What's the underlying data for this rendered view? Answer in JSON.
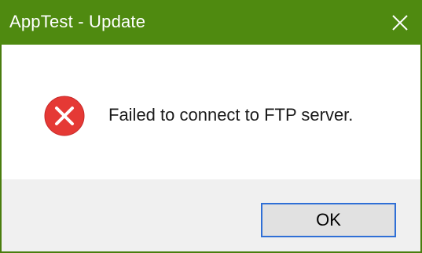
{
  "window": {
    "title": "AppTest - Update"
  },
  "titlebar": {
    "close_icon": "close-icon",
    "accent_color": "#4f8a10"
  },
  "dialog": {
    "icon": "error-icon",
    "icon_color": "#e53935",
    "message": "Failed to connect to FTP server."
  },
  "buttons": {
    "ok_label": "OK"
  }
}
